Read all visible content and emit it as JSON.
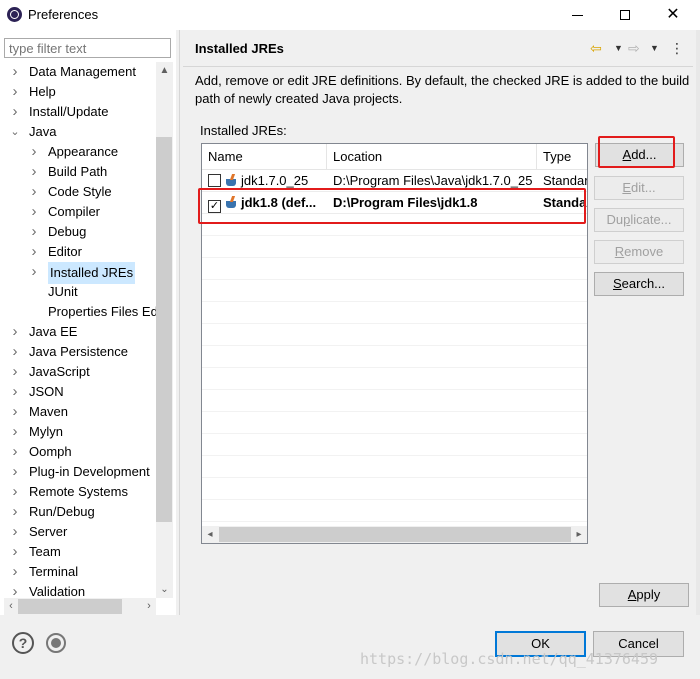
{
  "window": {
    "title": "Preferences"
  },
  "left": {
    "filter_placeholder": "type filter text",
    "tree": [
      {
        "label": "Data Management",
        "level": 0,
        "chevron": "right"
      },
      {
        "label": "Help",
        "level": 0,
        "chevron": "right"
      },
      {
        "label": "Install/Update",
        "level": 0,
        "chevron": "right"
      },
      {
        "label": "Java",
        "level": 0,
        "chevron": "down"
      },
      {
        "label": "Appearance",
        "level": 1,
        "chevron": "right"
      },
      {
        "label": "Build Path",
        "level": 1,
        "chevron": "right"
      },
      {
        "label": "Code Style",
        "level": 1,
        "chevron": "right"
      },
      {
        "label": "Compiler",
        "level": 1,
        "chevron": "right"
      },
      {
        "label": "Debug",
        "level": 1,
        "chevron": "right"
      },
      {
        "label": "Editor",
        "level": 1,
        "chevron": "right"
      },
      {
        "label": "Installed JREs",
        "level": 1,
        "chevron": "right",
        "selected": true
      },
      {
        "label": "JUnit",
        "level": 1,
        "chevron": "none"
      },
      {
        "label": "Properties Files Ed",
        "level": 1,
        "chevron": "none"
      },
      {
        "label": "Java EE",
        "level": 0,
        "chevron": "right"
      },
      {
        "label": "Java Persistence",
        "level": 0,
        "chevron": "right"
      },
      {
        "label": "JavaScript",
        "level": 0,
        "chevron": "right"
      },
      {
        "label": "JSON",
        "level": 0,
        "chevron": "right"
      },
      {
        "label": "Maven",
        "level": 0,
        "chevron": "right"
      },
      {
        "label": "Mylyn",
        "level": 0,
        "chevron": "right"
      },
      {
        "label": "Oomph",
        "level": 0,
        "chevron": "right"
      },
      {
        "label": "Plug-in Development",
        "level": 0,
        "chevron": "right"
      },
      {
        "label": "Remote Systems",
        "level": 0,
        "chevron": "right"
      },
      {
        "label": "Run/Debug",
        "level": 0,
        "chevron": "right"
      },
      {
        "label": "Server",
        "level": 0,
        "chevron": "right"
      },
      {
        "label": "Team",
        "level": 0,
        "chevron": "right"
      },
      {
        "label": "Terminal",
        "level": 0,
        "chevron": "right"
      },
      {
        "label": "Validation",
        "level": 0,
        "chevron": "right"
      }
    ]
  },
  "right": {
    "page_title": "Installed JREs",
    "description": "Add, remove or edit JRE definitions. By default, the checked JRE is added to the build path of newly created Java projects.",
    "installed_label": "Installed JREs:",
    "table": {
      "columns": [
        "Name",
        "Location",
        "Type"
      ],
      "rows": [
        {
          "checked": false,
          "name": "jdk1.7.0_25",
          "location": "D:\\Program Files\\Java\\jdk1.7.0_25",
          "type": "Standar",
          "bold": false
        },
        {
          "checked": true,
          "name": "jdk1.8 (def...",
          "location": "D:\\Program Files\\jdk1.8",
          "type": "Standa",
          "bold": true
        }
      ]
    },
    "buttons": {
      "add": {
        "pre": "",
        "mnemonic": "A",
        "post": "dd..."
      },
      "edit": {
        "pre": "",
        "mnemonic": "E",
        "post": "dit..."
      },
      "duplicate": {
        "pre": "Du",
        "mnemonic": "p",
        "post": "licate..."
      },
      "remove": {
        "pre": "",
        "mnemonic": "R",
        "post": "emove"
      },
      "search": {
        "pre": "",
        "mnemonic": "S",
        "post": "earch..."
      },
      "apply": {
        "pre": "",
        "mnemonic": "A",
        "post": "pply"
      }
    }
  },
  "bottom": {
    "ok": "OK",
    "cancel": "Cancel",
    "watermark": "https://blog.csdn.net/qq_41376459"
  },
  "colors": {
    "highlight_box": "#e21b1b",
    "selection": "#cce8ff",
    "default_button_border": "#0078d7"
  }
}
